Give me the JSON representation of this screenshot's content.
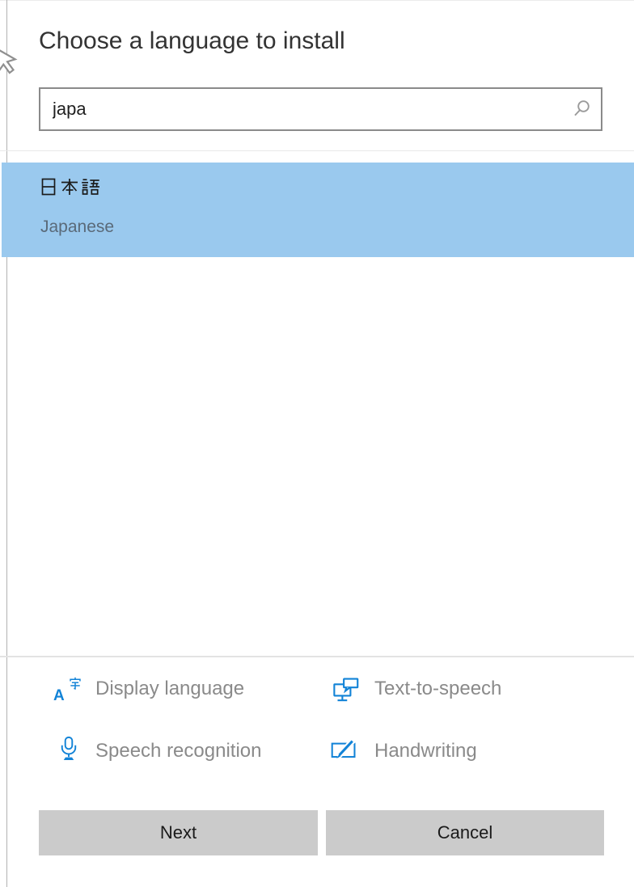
{
  "dialog": {
    "title": "Choose a language to install",
    "search": {
      "value": "japa",
      "icon": "search-icon"
    },
    "results": [
      {
        "native_name": "日本語",
        "english_name": "Japanese",
        "selected": true
      }
    ],
    "legend": [
      {
        "icon": "display-language-icon",
        "label": "Display language"
      },
      {
        "icon": "text-to-speech-icon",
        "label": "Text-to-speech"
      },
      {
        "icon": "speech-recognition-icon",
        "label": "Speech recognition"
      },
      {
        "icon": "handwriting-icon",
        "label": "Handwriting"
      }
    ],
    "buttons": {
      "next": "Next",
      "cancel": "Cancel"
    },
    "colors": {
      "selection_blue": "#9ac9ee",
      "icon_blue": "#1283d7",
      "legend_text_gray": "#8a8a8a",
      "button_gray": "#cbcbcb",
      "search_border_gray": "#8a8a8a"
    }
  }
}
